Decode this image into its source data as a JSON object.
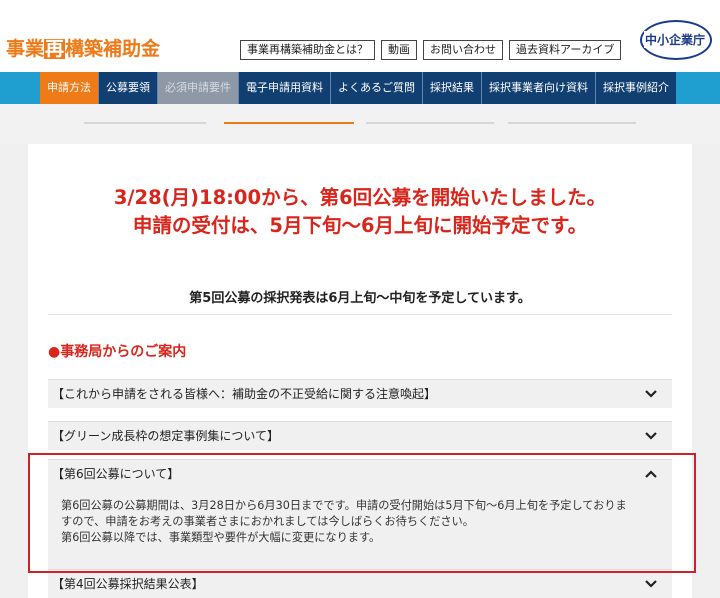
{
  "header": {
    "logo_pre": "事業",
    "logo_mid": "再",
    "logo_post": "構築補助金",
    "agency": "中小企業庁"
  },
  "top_links": [
    {
      "label": "事業再構築補助金とは？"
    },
    {
      "label": "動画"
    },
    {
      "label": "お問い合わせ"
    },
    {
      "label": "過去資料アーカイブ"
    }
  ],
  "nav": [
    {
      "label": "申請方法",
      "state": "active"
    },
    {
      "label": "公募要領",
      "state": "normal"
    },
    {
      "label": "必須申請要件",
      "state": "disabled"
    },
    {
      "label": "電子申請用資料",
      "state": "normal"
    },
    {
      "label": "よくあるご質問",
      "state": "normal"
    },
    {
      "label": "採択結果",
      "state": "normal"
    },
    {
      "label": "採択事業者向け資料",
      "state": "normal"
    },
    {
      "label": "採択事例紹介",
      "state": "normal"
    }
  ],
  "main": {
    "headline_line1": "3/28(月)18:00から、第6回公募を開始いたしました。",
    "headline_line2": "申請の受付は、5月下旬〜6月上旬に開始予定です。",
    "subheadline": "第5回公募の採択発表は6月上旬〜中旬を予定しています。",
    "section_title": "●事務局からのご案内"
  },
  "accordion": [
    {
      "title": "【これから申請をされる皆様へ：補助金の不正受給に関する注意喚起】",
      "expanded": false
    },
    {
      "title": "【グリーン成長枠の想定事例集について】",
      "expanded": false
    },
    {
      "title": "【第6回公募について】",
      "expanded": true,
      "body_line1": "第6回公募の公募期間は、3月28日から6月30日までです。申請の受付開始は5月下旬〜6月上旬を予定しておりま",
      "body_line2": "すので、申請をお考えの事業者さまにおかれましては今しばらくお待ちください。",
      "body_line3": "第6回公募以降では、事業類型や要件が大幅に変更になります。"
    },
    {
      "title": "【第4回公募採択結果公表】",
      "expanded": false
    }
  ],
  "colors": {
    "brand_orange": "#ef7a18",
    "nav_navy": "#123f72",
    "nav_band": "#1e9fcf",
    "alert_red": "#d9261c",
    "highlight_red": "#d0202a"
  }
}
